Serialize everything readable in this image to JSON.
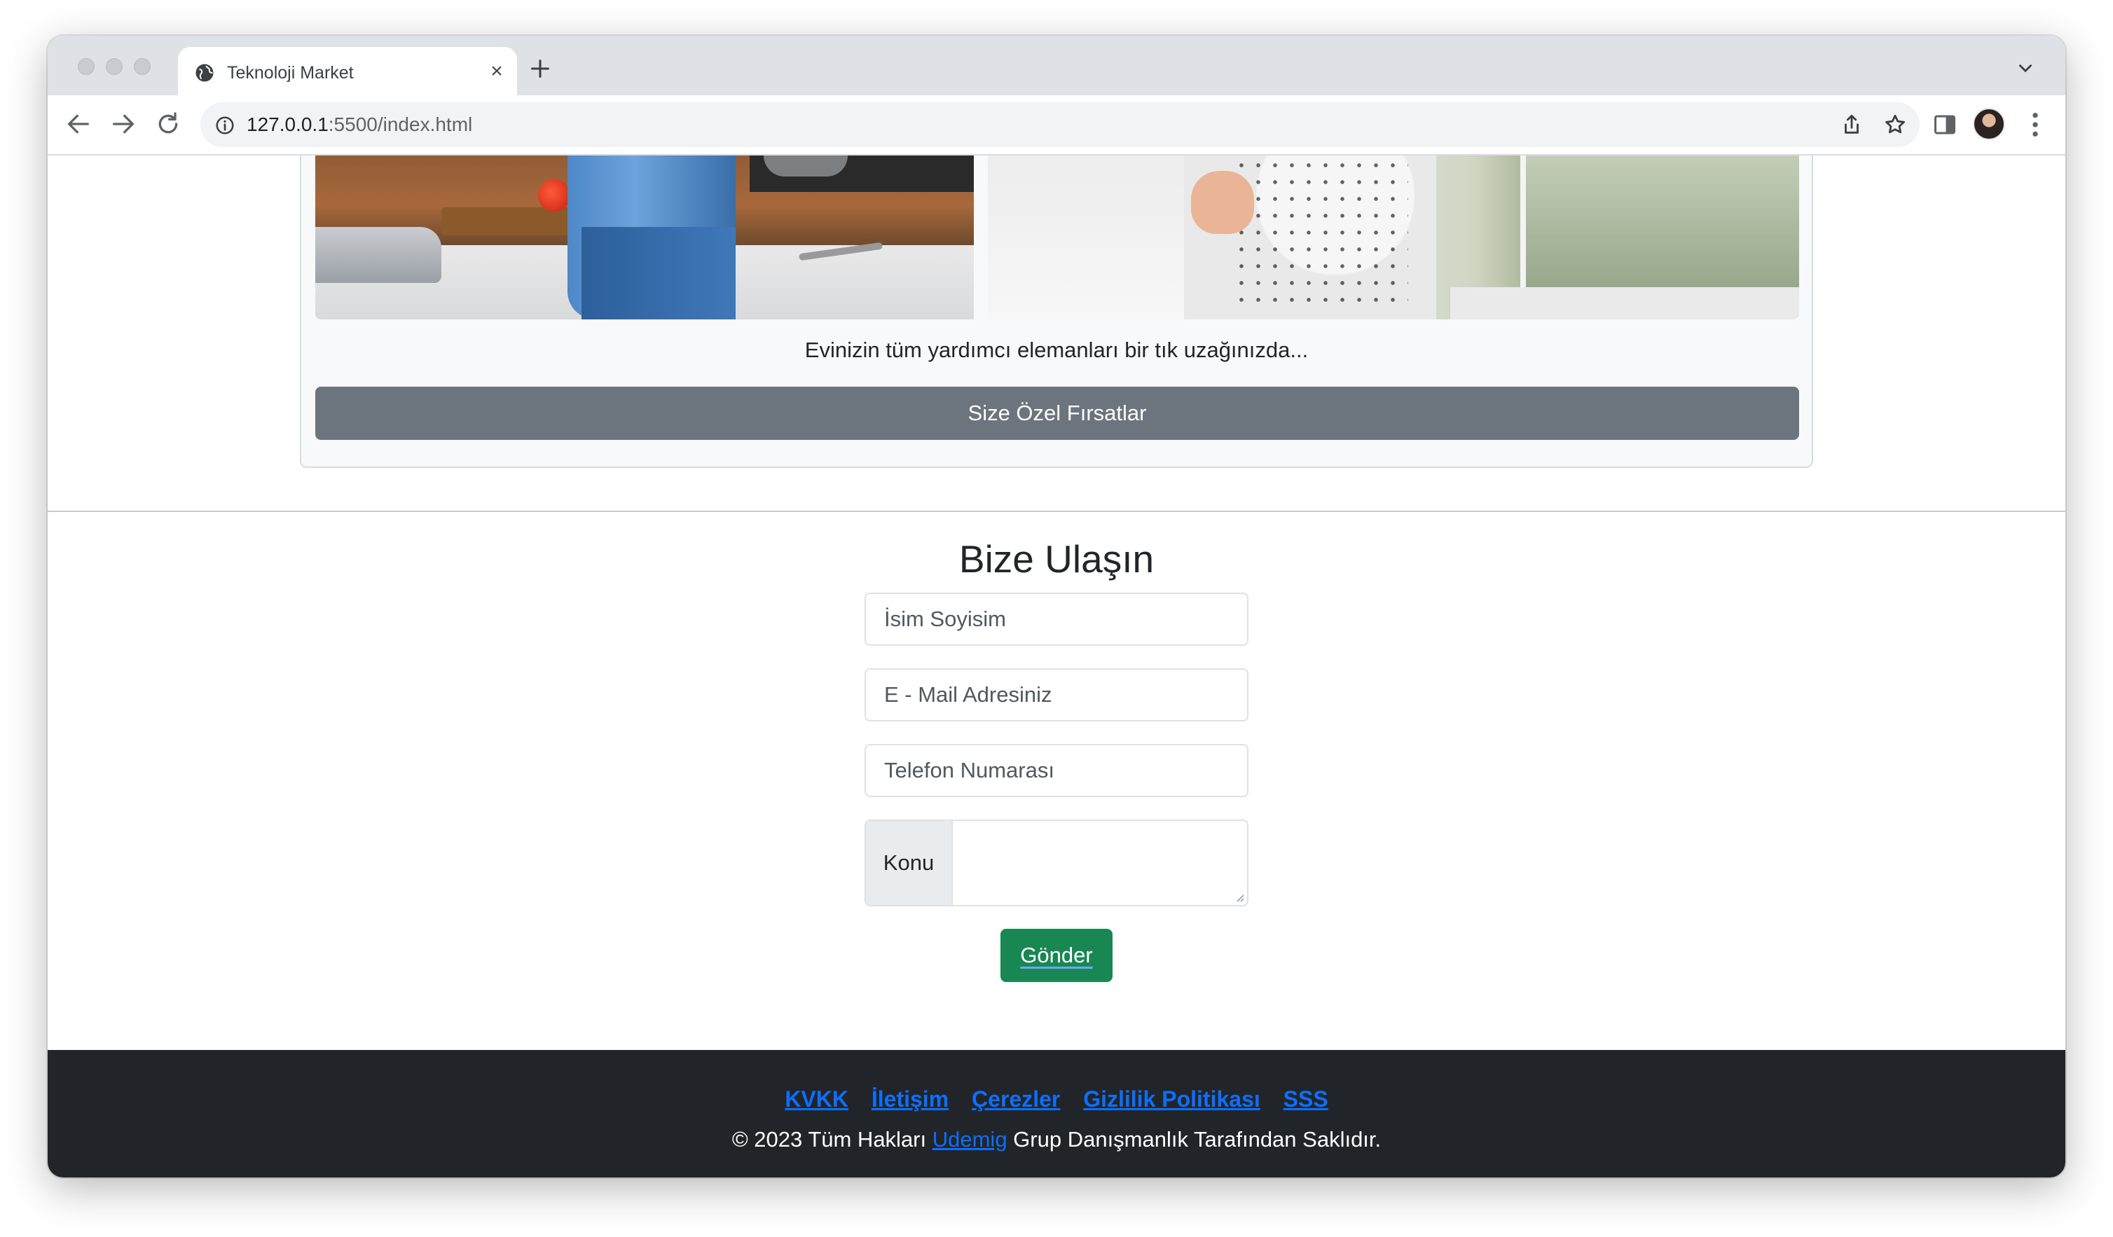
{
  "browser": {
    "tab_title": "Teknoloji Market",
    "url_host": "127.0.0.1",
    "url_rest": ":5500/index.html"
  },
  "hero": {
    "caption": "Evinizin tüm yardımcı elemanları bir tık uzağınızda...",
    "button_label": "Size Özel Fırsatlar"
  },
  "contact": {
    "title": "Bize Ulaşın",
    "name_placeholder": "İsim Soyisim",
    "email_placeholder": "E - Mail Adresiniz",
    "phone_placeholder": "Telefon Numarası",
    "subject_label": "Konu",
    "subject_value": "",
    "submit_label": "Gönder"
  },
  "footer": {
    "links": [
      "KVKK",
      "İletişim",
      "Çerezler",
      "Gizlilik Politikası",
      "SSS"
    ],
    "copyright_prefix": "© 2023 Tüm Hakları ",
    "copyright_link": "Udemig",
    "copyright_suffix": " Grup Danışmanlık Tarafından Saklıdır."
  },
  "colors": {
    "secondary_button": "#6c757d",
    "success_button": "#198754",
    "link": "#0d6efd",
    "footer_bg": "#212529"
  },
  "icons": [
    "globe-icon",
    "close-icon",
    "plus-icon",
    "chevron-down-icon",
    "back-arrow-icon",
    "forward-arrow-icon",
    "reload-icon",
    "info-icon",
    "share-icon",
    "star-icon",
    "side-panel-icon",
    "kebab-menu-icon"
  ]
}
